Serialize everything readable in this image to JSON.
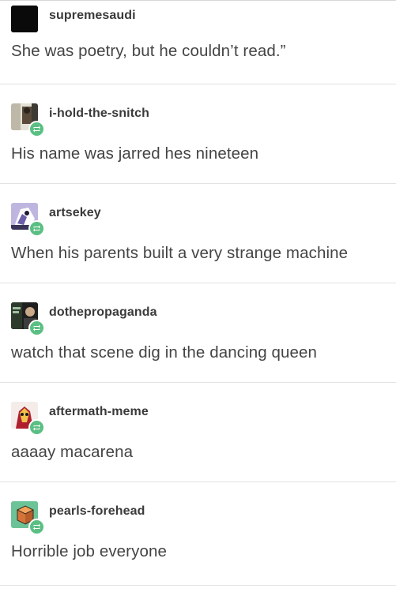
{
  "posts": [
    {
      "username": "supremesaudi",
      "text": "She was poetry, but he couldn’t read.”",
      "avatar_icon": "black-square-avatar",
      "reblog": false
    },
    {
      "username": "i-hold-the-snitch",
      "text": "His name was jarred hes nineteen",
      "avatar_icon": "photo-avatar",
      "reblog": true
    },
    {
      "username": "artsekey",
      "text": "When his parents built a very strange machine",
      "avatar_icon": "cartoon-avatar",
      "reblog": true
    },
    {
      "username": "dothepropaganda",
      "text": "watch that scene dig in the dancing queen",
      "avatar_icon": "photo-avatar",
      "reblog": true
    },
    {
      "username": "aftermath-meme",
      "text": "aaaay macarena",
      "avatar_icon": "cartoon-avatar",
      "reblog": true
    },
    {
      "username": "pearls-forehead",
      "text": "Horrible job everyone",
      "avatar_icon": "cube-avatar",
      "reblog": true
    }
  ],
  "colors": {
    "reblog_badge": "#5bbf83",
    "username": "#3a3a3a",
    "text": "#444444",
    "divider": "#e2e2e2"
  }
}
